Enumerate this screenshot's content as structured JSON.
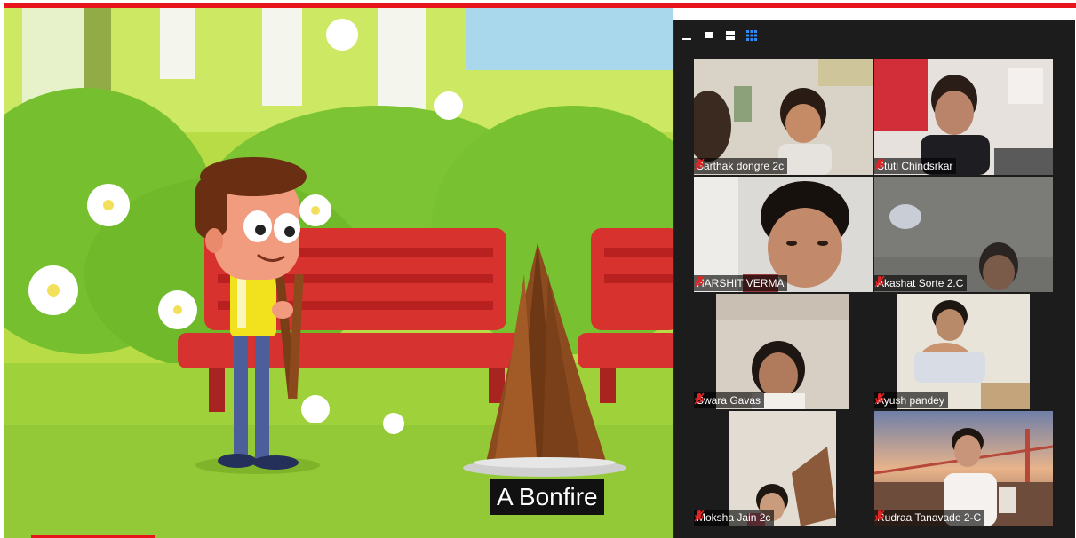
{
  "video": {
    "caption": "A Bonfire"
  },
  "gallery": {
    "view_icons": [
      "minimize-icon",
      "speaker-view-icon",
      "split-view-icon",
      "gallery-view-icon"
    ],
    "participants": [
      {
        "name": "Sarthak dongre 2c",
        "muted": true
      },
      {
        "name": "Stuti Chindsrkar",
        "muted": true
      },
      {
        "name": "HARSHIT VERMA",
        "muted": true
      },
      {
        "name": "Akashat Sorte 2.C",
        "muted": true
      },
      {
        "name": "Swara Gavas",
        "muted": true
      },
      {
        "name": "Ayush pandey",
        "muted": true
      },
      {
        "name": "Moksha Jain 2c",
        "muted": true
      },
      {
        "name": "Rudraa Tanavade 2-C",
        "muted": true
      }
    ]
  },
  "colors": {
    "accent_red": "#e8141b",
    "gallery_bg": "#1c1c1c",
    "active_view": "#2d8cff"
  }
}
